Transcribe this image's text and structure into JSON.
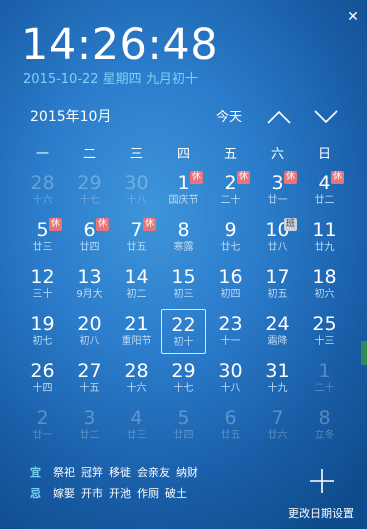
{
  "clock": {
    "time": "14:26:48",
    "date_line": "2015-10-22  星期四  九月初十"
  },
  "header": {
    "month_label": "2015年10月",
    "today_label": "今天"
  },
  "weekdays": [
    "一",
    "二",
    "三",
    "四",
    "五",
    "六",
    "日"
  ],
  "days": [
    {
      "num": "28",
      "lunar": "十六",
      "other": true
    },
    {
      "num": "29",
      "lunar": "十七",
      "other": true
    },
    {
      "num": "30",
      "lunar": "十八",
      "other": true
    },
    {
      "num": "1",
      "lunar": "国庆节",
      "badge": "休"
    },
    {
      "num": "2",
      "lunar": "二十",
      "badge": "休"
    },
    {
      "num": "3",
      "lunar": "廿一",
      "badge": "休"
    },
    {
      "num": "4",
      "lunar": "廿二",
      "badge": "休"
    },
    {
      "num": "5",
      "lunar": "廿三",
      "badge": "休"
    },
    {
      "num": "6",
      "lunar": "廿四",
      "badge": "休"
    },
    {
      "num": "7",
      "lunar": "廿五",
      "badge": "休"
    },
    {
      "num": "8",
      "lunar": "寒露"
    },
    {
      "num": "9",
      "lunar": "廿七"
    },
    {
      "num": "10",
      "lunar": "廿八",
      "badge": "班",
      "badge_type": "work"
    },
    {
      "num": "11",
      "lunar": "廿九"
    },
    {
      "num": "12",
      "lunar": "三十"
    },
    {
      "num": "13",
      "lunar": "9月大"
    },
    {
      "num": "14",
      "lunar": "初二"
    },
    {
      "num": "15",
      "lunar": "初三"
    },
    {
      "num": "16",
      "lunar": "初四"
    },
    {
      "num": "17",
      "lunar": "初五"
    },
    {
      "num": "18",
      "lunar": "初六"
    },
    {
      "num": "19",
      "lunar": "初七"
    },
    {
      "num": "20",
      "lunar": "初八"
    },
    {
      "num": "21",
      "lunar": "重阳节"
    },
    {
      "num": "22",
      "lunar": "初十",
      "selected": true
    },
    {
      "num": "23",
      "lunar": "十一"
    },
    {
      "num": "24",
      "lunar": "霜降"
    },
    {
      "num": "25",
      "lunar": "十三"
    },
    {
      "num": "26",
      "lunar": "十四"
    },
    {
      "num": "27",
      "lunar": "十五"
    },
    {
      "num": "28",
      "lunar": "十六"
    },
    {
      "num": "29",
      "lunar": "十七"
    },
    {
      "num": "30",
      "lunar": "十八"
    },
    {
      "num": "31",
      "lunar": "十九"
    },
    {
      "num": "1",
      "lunar": "二十",
      "other": true
    },
    {
      "num": "2",
      "lunar": "廿一",
      "other": true
    },
    {
      "num": "3",
      "lunar": "廿二",
      "other": true
    },
    {
      "num": "4",
      "lunar": "廿三",
      "other": true
    },
    {
      "num": "5",
      "lunar": "廿四",
      "other": true
    },
    {
      "num": "6",
      "lunar": "廿五",
      "other": true
    },
    {
      "num": "7",
      "lunar": "廿六",
      "other": true
    },
    {
      "num": "8",
      "lunar": "立冬",
      "other": true
    }
  ],
  "almanac": {
    "yi_label": "宜",
    "yi_items": [
      "祭祀",
      "冠笄",
      "移徙",
      "会亲友",
      "纳财"
    ],
    "ji_label": "忌",
    "ji_items": [
      "嫁娶",
      "开市",
      "开池",
      "作厕",
      "破土"
    ]
  },
  "footer": {
    "change_date_settings": "更改日期设置"
  },
  "icons": {
    "close": "close-icon",
    "prev": "chevron-up-icon",
    "next": "chevron-down-icon",
    "add": "plus-icon"
  },
  "colors": {
    "accent": "#7fd0f4",
    "holiday_badge": "#e8757a",
    "work_badge": "#c9d0d8"
  }
}
